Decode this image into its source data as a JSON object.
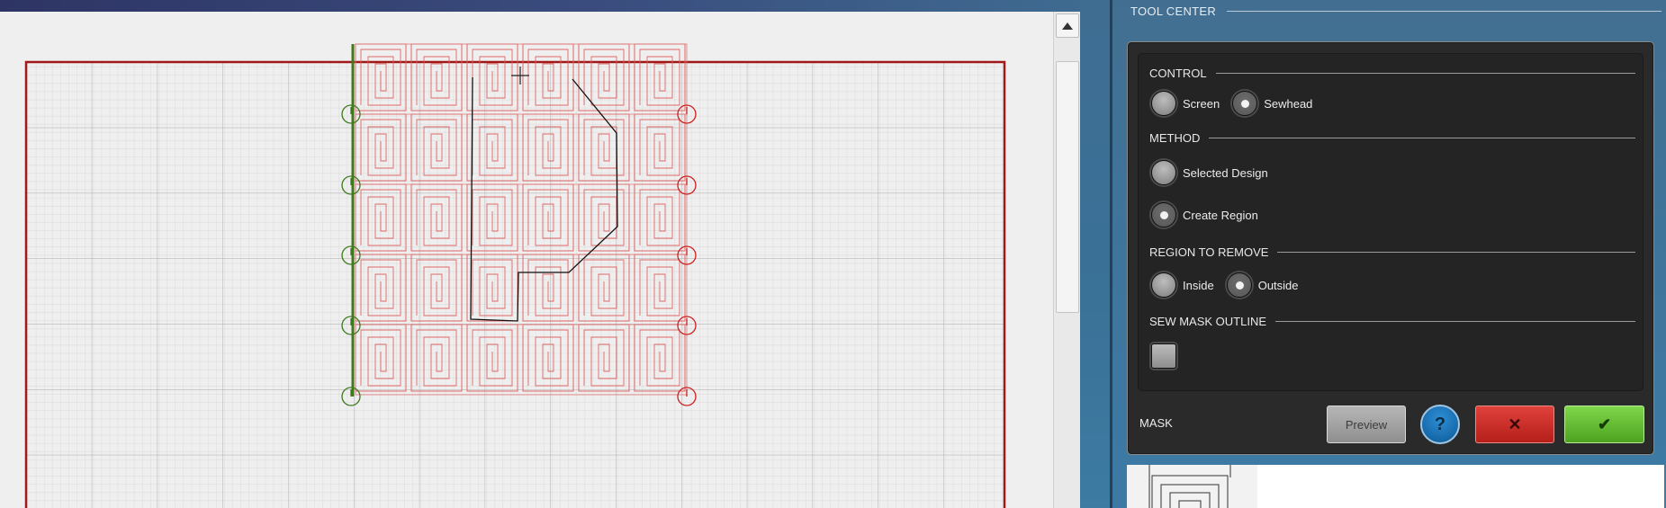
{
  "tool_center": {
    "title": "TOOL CENTER",
    "control": {
      "heading": "CONTROL",
      "options": [
        {
          "label": "Screen",
          "selected": false
        },
        {
          "label": "Sewhead",
          "selected": true
        }
      ]
    },
    "method": {
      "heading": "METHOD",
      "options": [
        {
          "label": "Selected Design",
          "selected": false
        },
        {
          "label": "Create Region",
          "selected": true
        }
      ]
    },
    "region_to_remove": {
      "heading": "REGION TO REMOVE",
      "options": [
        {
          "label": "Inside",
          "selected": false
        },
        {
          "label": "Outside",
          "selected": true
        }
      ]
    },
    "sew_mask_outline": {
      "heading": "SEW MASK OUTLINE",
      "checked": false
    },
    "footer": {
      "label": "MASK",
      "preview_label": "Preview",
      "help_glyph": "?",
      "cancel_glyph": "✕",
      "ok_glyph": "✔"
    }
  },
  "icons": {
    "scroll_up": "triangle-up-icon",
    "help": "question-icon",
    "cancel": "x-icon",
    "ok": "checkmark-icon"
  },
  "colors": {
    "hoop_border": "#a01818",
    "design_stroke": "#e05a5a",
    "mask_path": "#111111",
    "left_edge": "#3d7a1c",
    "cancel": "#c4271f",
    "ok": "#5fbd2f",
    "help": "#1f7cc2"
  }
}
